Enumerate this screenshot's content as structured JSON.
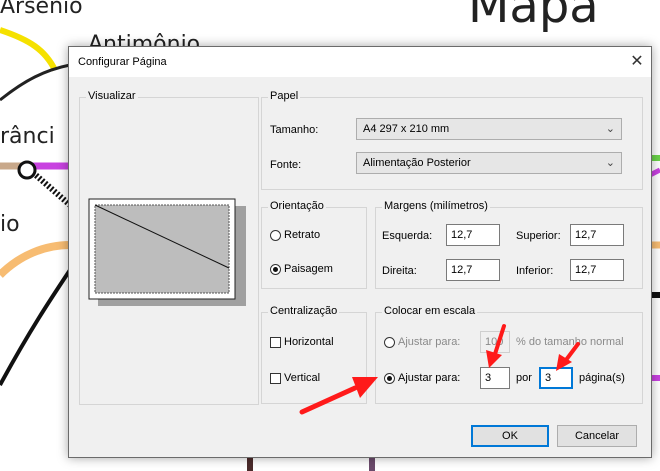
{
  "background": {
    "texts": [
      "Arsênio",
      "Antimônio",
      "rânci",
      "io",
      "Mapa"
    ],
    "metro_colors": {
      "yellow": "#f5e100",
      "purple": "#c842e0",
      "peach": "#f7bc72",
      "green": "#6bd34a"
    }
  },
  "dialog": {
    "title": "Configurar Página",
    "close_label": "✕",
    "preview": {
      "legend": "Visualizar"
    },
    "paper": {
      "legend": "Papel",
      "size_label": "Tamanho:",
      "size_value": "A4 297 x 210 mm",
      "source_label": "Fonte:",
      "source_value": "Alimentação Posterior"
    },
    "orientation": {
      "legend": "Orientação",
      "portrait_label": "Retrato",
      "landscape_label": "Paisagem",
      "selected": "Paisagem"
    },
    "margins": {
      "legend": "Margens (milímetros)",
      "left_label": "Esquerda:",
      "left_value": "12,7",
      "top_label": "Superior:",
      "top_value": "12,7",
      "right_label": "Direita:",
      "right_value": "12,7",
      "bottom_label": "Inferior:",
      "bottom_value": "12,7"
    },
    "centering": {
      "legend": "Centralização",
      "horizontal_label": "Horizontal",
      "vertical_label": "Vertical"
    },
    "scaling": {
      "legend": "Colocar em escala",
      "adjust_pct_label": "Ajustar para:",
      "adjust_pct_value": "100",
      "adjust_pct_suffix": "% do tamanho normal",
      "adjust_pages_label": "Ajustar para:",
      "pages_wide_value": "3",
      "by_label": "por",
      "pages_tall_value": "3",
      "pages_suffix": "página(s)"
    },
    "buttons": {
      "ok": "OK",
      "cancel": "Cancelar"
    }
  },
  "annotations": {
    "arrow_color": "#ff1a1a"
  }
}
